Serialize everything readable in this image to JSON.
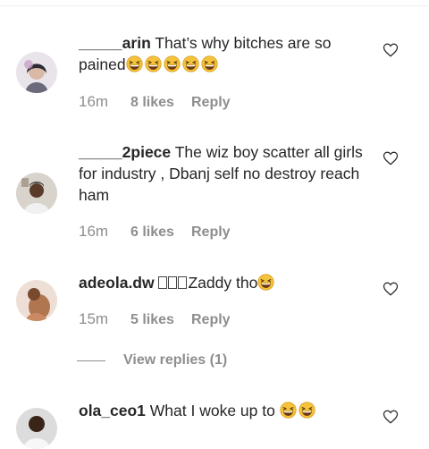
{
  "comments": [
    {
      "username": "_____arin",
      "text_line1": "That’s why bitches are so",
      "text_line2": "pained",
      "emoji_count": 5,
      "emoji_name": "grinning-squinting-face",
      "time": "16m",
      "likes": "8 likes",
      "reply": "Reply",
      "avatar": "avatar-woman-pink",
      "liked": false
    },
    {
      "username": "_____2piece",
      "text": "The wiz boy scatter all girls for industry , Dbanj self no destroy reach ham",
      "time": "16m",
      "likes": "6 likes",
      "reply": "Reply",
      "avatar": "avatar-man-dark",
      "liked": false
    },
    {
      "username": "adeola.dw",
      "text": "Zaddy tho",
      "emoji_count": 1,
      "emoji_name": "grinning-squinting-face",
      "time": "15m",
      "likes": "5 likes",
      "reply": "Reply",
      "avatar": "avatar-woman-brown",
      "view_replies": "View replies (1)"
    },
    {
      "username": "ola_ceo1",
      "text": "What I woke up to",
      "emoji_count": 2,
      "emoji_name": "grinning-squinting-face",
      "avatar": "avatar-man-white"
    }
  ],
  "colors": {
    "text": "#262626",
    "muted": "#8e8e8e",
    "heart": "#262626"
  }
}
